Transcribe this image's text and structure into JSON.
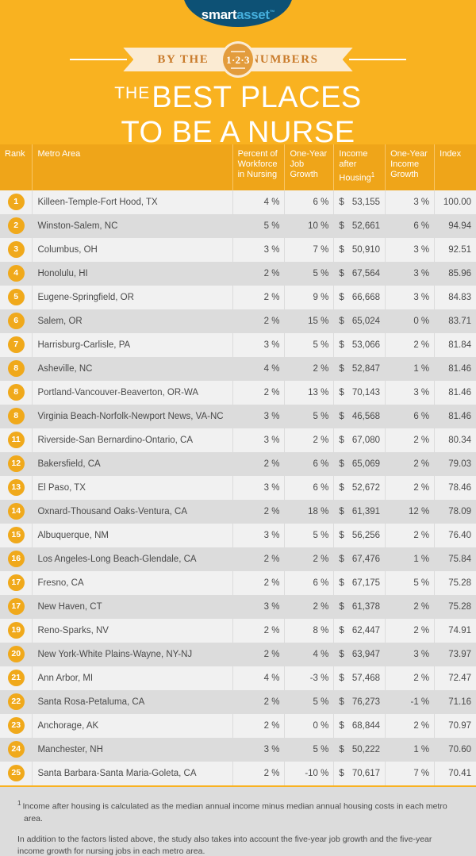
{
  "brand": {
    "logo_smart": "smart",
    "logo_asset": "asset",
    "logo_tm": "™",
    "logo_bg": "#0D5175"
  },
  "ribbon": {
    "left_word": "BY THE",
    "right_word": "NUMBERS",
    "badge": "1·2·3",
    "badge_color": "#E39C3C"
  },
  "title": {
    "the": "THE",
    "line1_main": "BEST PLACES",
    "line2": "TO BE A NURSE"
  },
  "theme": {
    "background": "#F9B220",
    "header_row": "#EFA519",
    "row_odd": "#F1F1F1",
    "row_even": "#DCDCDC",
    "rank_badge": "#F0A91B",
    "text": "#4A4A4A"
  },
  "table": {
    "headers": {
      "rank": "Rank",
      "metro": "Metro Area",
      "pct_workforce": "Percent of Workforce in Nursing",
      "job_growth": "One-Year Job Growth",
      "income_after_housing": "Income after Housing",
      "income_after_housing_sup": "1",
      "income_growth": "One-Year Income Growth",
      "index": "Index"
    },
    "rows": [
      {
        "rank": "1",
        "metro": "Killeen-Temple-Fort Hood, TX",
        "pct": "4 %",
        "job": "6 %",
        "dollar": "$",
        "income": "53,155",
        "incgrowth": "3 %",
        "index": "100.00"
      },
      {
        "rank": "2",
        "metro": "Winston-Salem, NC",
        "pct": "5 %",
        "job": "10 %",
        "dollar": "$",
        "income": "52,661",
        "incgrowth": "6 %",
        "index": "94.94"
      },
      {
        "rank": "3",
        "metro": "Columbus, OH",
        "pct": "3 %",
        "job": "7 %",
        "dollar": "$",
        "income": "50,910",
        "incgrowth": "3 %",
        "index": "92.51"
      },
      {
        "rank": "4",
        "metro": "Honolulu, HI",
        "pct": "2 %",
        "job": "5 %",
        "dollar": "$",
        "income": "67,564",
        "incgrowth": "3 %",
        "index": "85.96"
      },
      {
        "rank": "5",
        "metro": "Eugene-Springfield, OR",
        "pct": "2 %",
        "job": "9 %",
        "dollar": "$",
        "income": "66,668",
        "incgrowth": "3 %",
        "index": "84.83"
      },
      {
        "rank": "6",
        "metro": "Salem, OR",
        "pct": "2 %",
        "job": "15 %",
        "dollar": "$",
        "income": "65,024",
        "incgrowth": "0 %",
        "index": "83.71"
      },
      {
        "rank": "7",
        "metro": "Harrisburg-Carlisle, PA",
        "pct": "3 %",
        "job": "5 %",
        "dollar": "$",
        "income": "53,066",
        "incgrowth": "2 %",
        "index": "81.84"
      },
      {
        "rank": "8",
        "metro": "Asheville, NC",
        "pct": "4 %",
        "job": "2 %",
        "dollar": "$",
        "income": "52,847",
        "incgrowth": "1 %",
        "index": "81.46"
      },
      {
        "rank": "8",
        "metro": "Portland-Vancouver-Beaverton, OR-WA",
        "pct": "2 %",
        "job": "13 %",
        "dollar": "$",
        "income": "70,143",
        "incgrowth": "3 %",
        "index": "81.46"
      },
      {
        "rank": "8",
        "metro": "Virginia Beach-Norfolk-Newport News, VA-NC",
        "pct": "3 %",
        "job": "5 %",
        "dollar": "$",
        "income": "46,568",
        "incgrowth": "6 %",
        "index": "81.46"
      },
      {
        "rank": "11",
        "metro": "Riverside-San Bernardino-Ontario, CA",
        "pct": "3 %",
        "job": "2 %",
        "dollar": "$",
        "income": "67,080",
        "incgrowth": "2 %",
        "index": "80.34"
      },
      {
        "rank": "12",
        "metro": "Bakersfield, CA",
        "pct": "2 %",
        "job": "6 %",
        "dollar": "$",
        "income": "65,069",
        "incgrowth": "2 %",
        "index": "79.03"
      },
      {
        "rank": "13",
        "metro": "El Paso, TX",
        "pct": "3 %",
        "job": "6 %",
        "dollar": "$",
        "income": "52,672",
        "incgrowth": "2 %",
        "index": "78.46"
      },
      {
        "rank": "14",
        "metro": "Oxnard-Thousand Oaks-Ventura, CA",
        "pct": "2 %",
        "job": "18 %",
        "dollar": "$",
        "income": "61,391",
        "incgrowth": "12 %",
        "index": "78.09"
      },
      {
        "rank": "15",
        "metro": "Albuquerque, NM",
        "pct": "3 %",
        "job": "5 %",
        "dollar": "$",
        "income": "56,256",
        "incgrowth": "2 %",
        "index": "76.40"
      },
      {
        "rank": "16",
        "metro": "Los Angeles-Long Beach-Glendale, CA",
        "pct": "2 %",
        "job": "2 %",
        "dollar": "$",
        "income": "67,476",
        "incgrowth": "1 %",
        "index": "75.84"
      },
      {
        "rank": "17",
        "metro": "Fresno, CA",
        "pct": "2 %",
        "job": "6 %",
        "dollar": "$",
        "income": "67,175",
        "incgrowth": "5 %",
        "index": "75.28"
      },
      {
        "rank": "17",
        "metro": "New Haven, CT",
        "pct": "3 %",
        "job": "2 %",
        "dollar": "$",
        "income": "61,378",
        "incgrowth": "2 %",
        "index": "75.28"
      },
      {
        "rank": "19",
        "metro": "Reno-Sparks, NV",
        "pct": "2 %",
        "job": "8 %",
        "dollar": "$",
        "income": "62,447",
        "incgrowth": "2 %",
        "index": "74.91"
      },
      {
        "rank": "20",
        "metro": "New York-White Plains-Wayne, NY-NJ",
        "pct": "2 %",
        "job": "4 %",
        "dollar": "$",
        "income": "63,947",
        "incgrowth": "3 %",
        "index": "73.97"
      },
      {
        "rank": "21",
        "metro": "Ann Arbor, MI",
        "pct": "4 %",
        "job": "-3 %",
        "dollar": "$",
        "income": "57,468",
        "incgrowth": "2 %",
        "index": "72.47"
      },
      {
        "rank": "22",
        "metro": "Santa Rosa-Petaluma, CA",
        "pct": "2 %",
        "job": "5 %",
        "dollar": "$",
        "income": "76,273",
        "incgrowth": "-1 %",
        "index": "71.16"
      },
      {
        "rank": "23",
        "metro": "Anchorage, AK",
        "pct": "2 %",
        "job": "0 %",
        "dollar": "$",
        "income": "68,844",
        "incgrowth": "2 %",
        "index": "70.97"
      },
      {
        "rank": "24",
        "metro": "Manchester, NH",
        "pct": "3 %",
        "job": "5 %",
        "dollar": "$",
        "income": "50,222",
        "incgrowth": "1 %",
        "index": "70.60"
      },
      {
        "rank": "25",
        "metro": "Santa Barbara-Santa Maria-Goleta, CA",
        "pct": "2 %",
        "job": "-10 %",
        "dollar": "$",
        "income": "70,617",
        "incgrowth": "7 %",
        "index": "70.41"
      }
    ]
  },
  "footnotes": {
    "mark": "1",
    "note1": "Income after housing is calculated as the median annual income minus median annual housing costs in each metro area.",
    "note2": "In addition to the factors listed above, the study also takes into account the five-year job growth and the five-year income growth for nursing jobs in each metro area."
  }
}
